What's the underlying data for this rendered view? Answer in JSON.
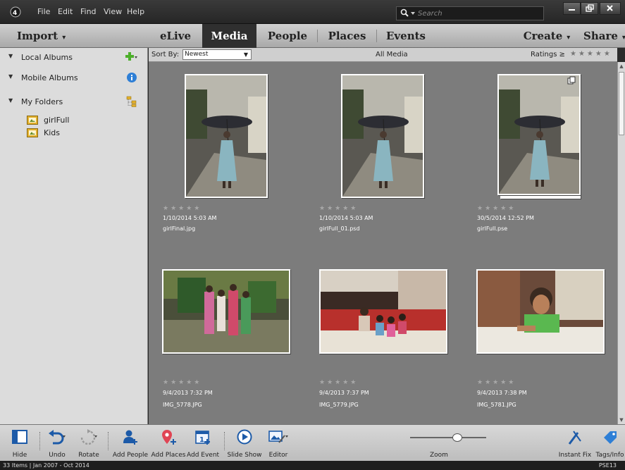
{
  "window": {
    "menu": [
      "File",
      "Edit",
      "Find",
      "View",
      "Help"
    ],
    "search_placeholder": "Search",
    "buttons": [
      "minimize",
      "maximize",
      "close"
    ]
  },
  "tabs": {
    "import": "Import",
    "items": [
      "eLive",
      "Media",
      "People",
      "Places",
      "Events"
    ],
    "active": "Media",
    "create": "Create",
    "share": "Share"
  },
  "sidebar": {
    "local_albums": "Local Albums",
    "mobile_albums": "Mobile Albums",
    "my_folders": "My Folders",
    "folders": [
      "girlFull",
      "Kids"
    ]
  },
  "options": {
    "sort_label": "Sort By:",
    "sort_value": "Newest",
    "view_label": "All Media",
    "ratings_label": "Ratings ≥"
  },
  "media": [
    {
      "date": "1/10/2014 5:03 AM",
      "name": "girlFinal.jpg",
      "kind": "girl",
      "stack": false,
      "rating": 0
    },
    {
      "date": "1/10/2014 5:03 AM",
      "name": "girlFull_01.psd",
      "kind": "girl",
      "stack": false,
      "rating": 0
    },
    {
      "date": "30/5/2014 12:52 PM",
      "name": "girlFull.pse",
      "kind": "girl",
      "stack": true,
      "rating": 0
    },
    {
      "date": "9/4/2013 7:32 PM",
      "name": "IMG_5778.JPG",
      "kind": "kids1",
      "stack": false,
      "rating": 0
    },
    {
      "date": "9/4/2013 7:37 PM",
      "name": "IMG_5779.JPG",
      "kind": "kids2",
      "stack": false,
      "rating": 0
    },
    {
      "date": "9/4/2013 7:38 PM",
      "name": "IMG_5781.JPG",
      "kind": "kids3",
      "stack": false,
      "rating": 0
    }
  ],
  "toolbar": {
    "hide": "Hide",
    "undo": "Undo",
    "rotate": "Rotate",
    "add_people": "Add People",
    "add_places": "Add Places",
    "add_event": "Add Event",
    "slide_show": "Slide Show",
    "editor": "Editor",
    "zoom": "Zoom",
    "zoom_level": 0.62,
    "instant_fix": "Instant Fix",
    "tags_info": "Tags/Info"
  },
  "status": {
    "left": "33 Items  |  Jan 2007 - Oct 2014",
    "right": "PSE13"
  },
  "colors": {
    "accent_green": "#4caf2a",
    "info_blue": "#2e7fd6",
    "active_tab": "#2f2f2f",
    "grid_bg": "#7c7c7c"
  }
}
